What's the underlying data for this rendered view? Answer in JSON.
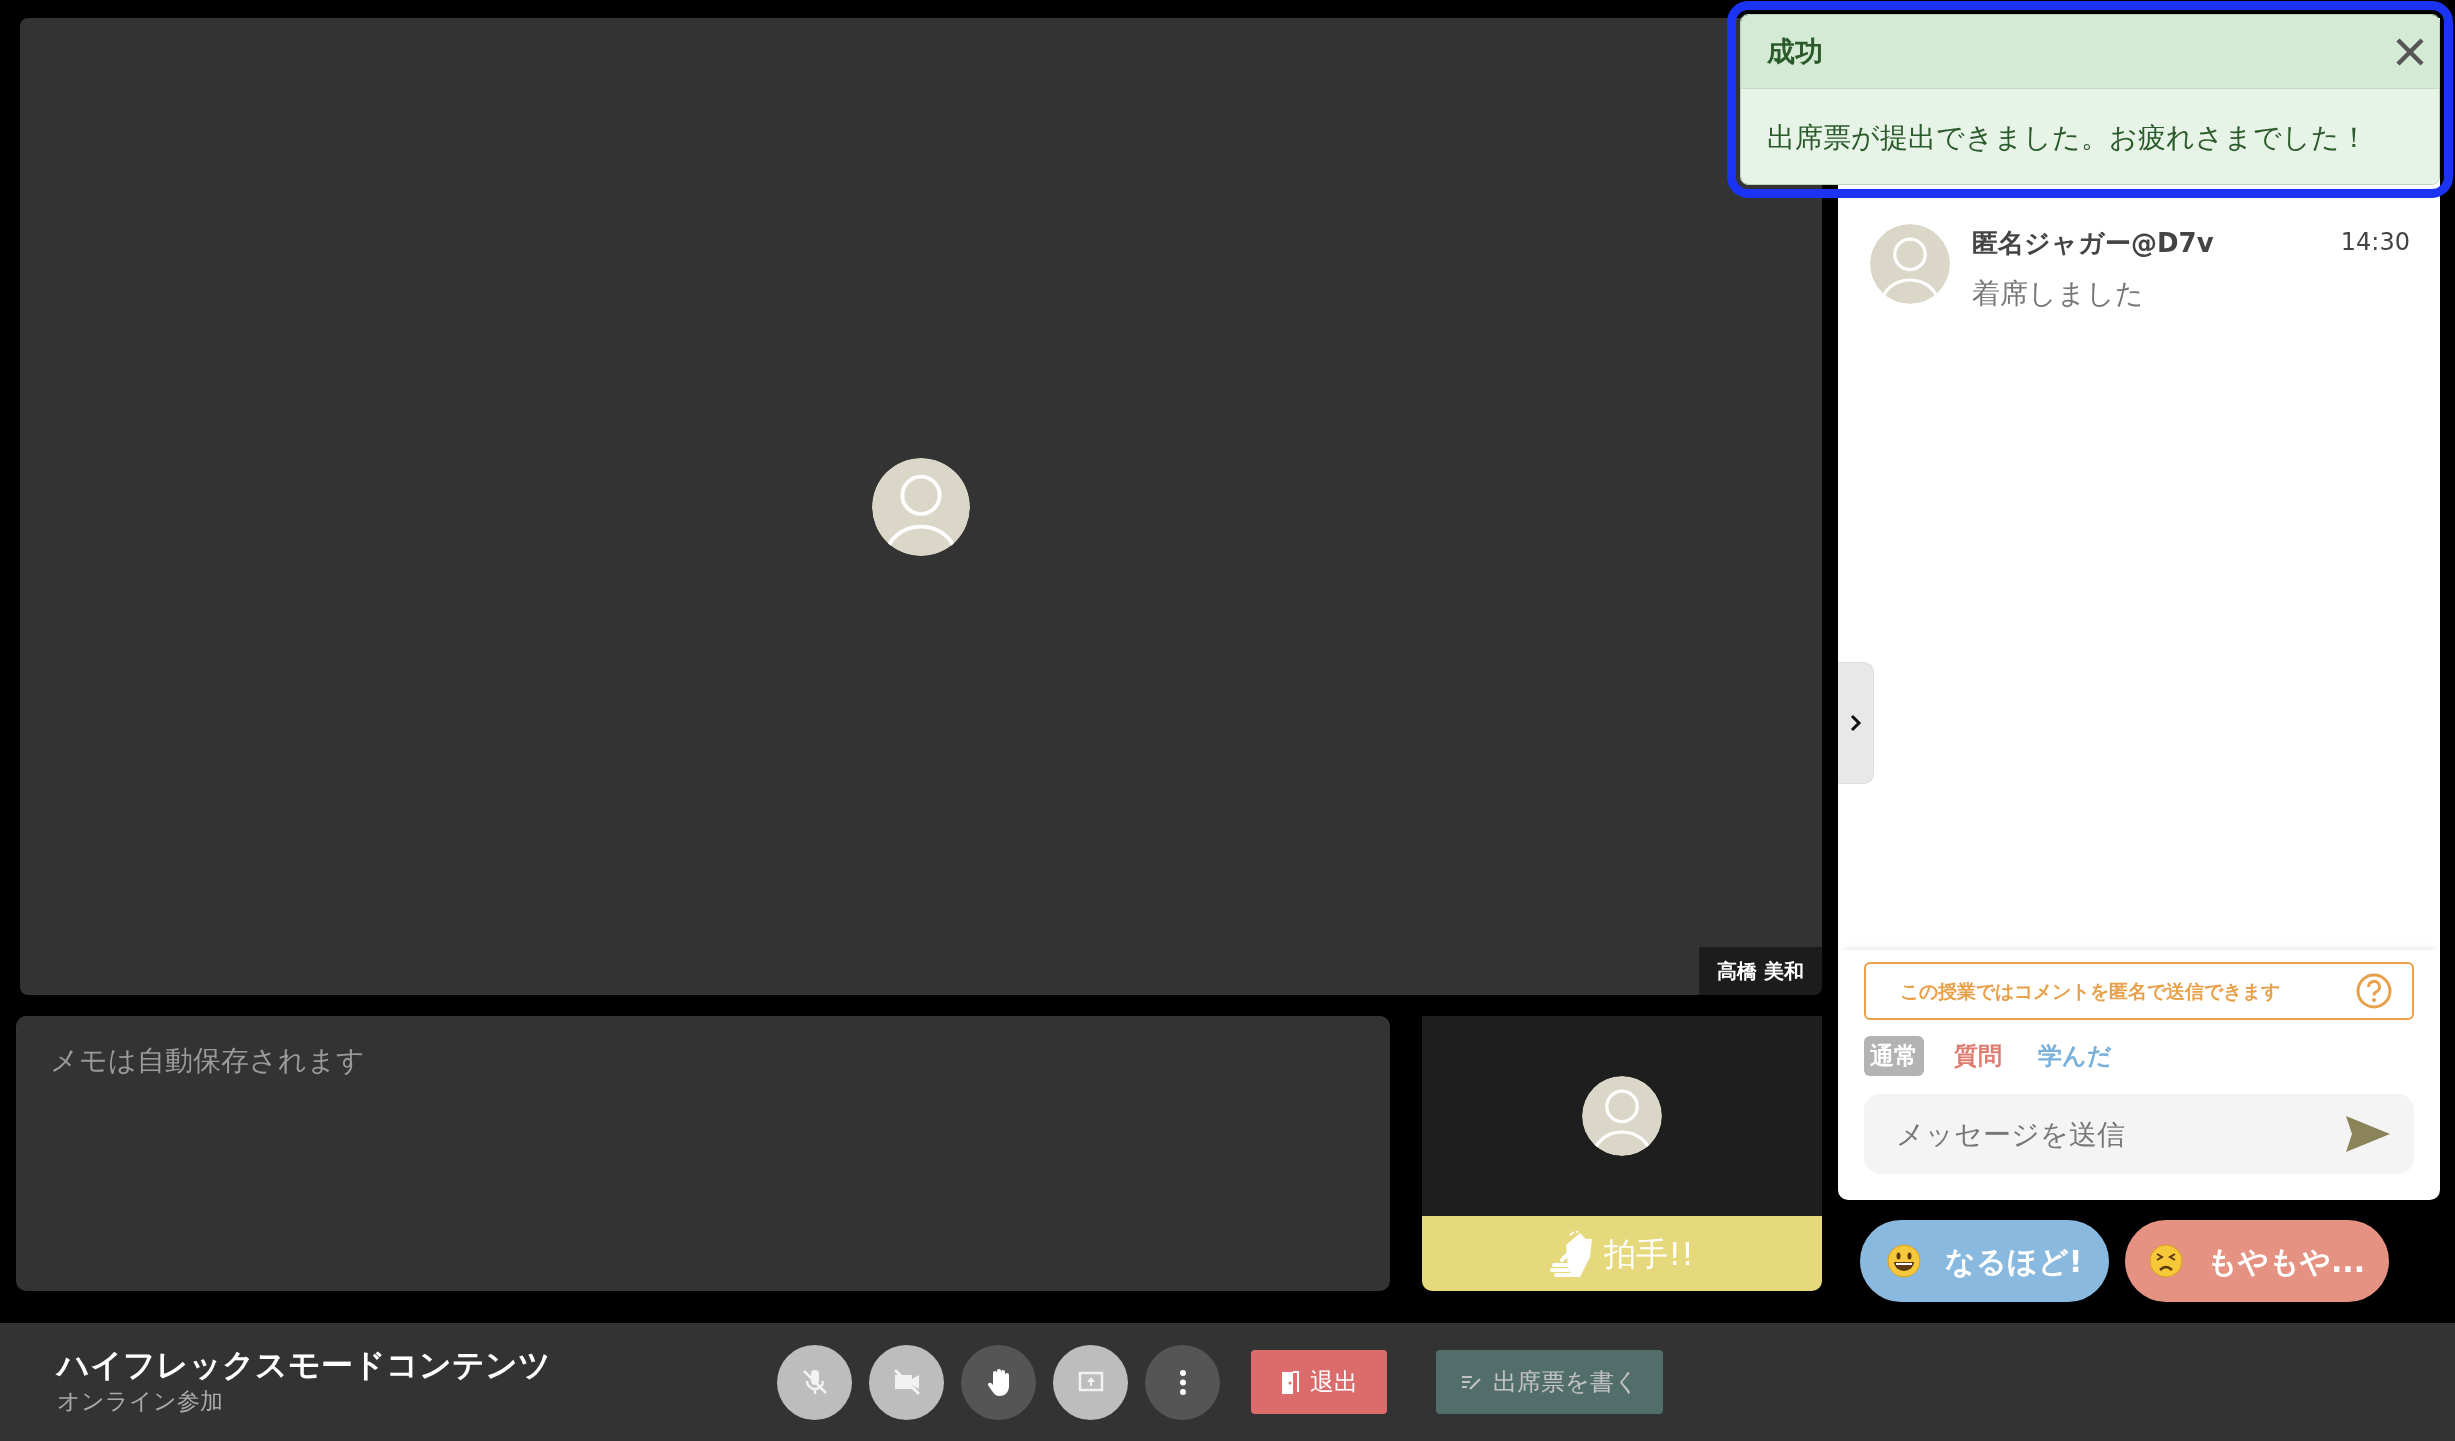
{
  "main_video": {
    "name": "高橋 美和"
  },
  "memo": {
    "placeholder": "メモは自動保存されます"
  },
  "self_video": {
    "clap_label": "拍手!!"
  },
  "panel": {
    "messages": [
      {
        "author": "匿名ジャガー@D7v",
        "time": "14:30",
        "text": "着席しました"
      }
    ],
    "anonymous_notice": "この授業ではコメントを匿名で送信できます",
    "comment_types": [
      {
        "label": "通常",
        "selected": true,
        "color": "#b3b3b3"
      },
      {
        "label": "質問",
        "selected": false,
        "color": "#e07b6f"
      },
      {
        "label": "学んだ",
        "selected": false,
        "color": "#7ab0dc"
      }
    ],
    "message_input": {
      "placeholder": "メッセージを送信"
    }
  },
  "reactions": [
    {
      "kind": "smile",
      "label": "なるほど!",
      "color": "#8ab9e0"
    },
    {
      "kind": "frown",
      "label": "もやもや...",
      "color": "#e59282"
    }
  ],
  "footer": {
    "title": "ハイフレックスモードコンテンツ",
    "subtitle": "オンライン参加",
    "controls": [
      {
        "kind": "mic",
        "disabled": true
      },
      {
        "kind": "camera",
        "disabled": true
      },
      {
        "kind": "hand",
        "disabled": false
      },
      {
        "kind": "share",
        "disabled": true
      },
      {
        "kind": "more",
        "disabled": false
      }
    ],
    "leave_button": "退出",
    "attendance_button": {
      "label": "出席票を書く",
      "disabled": true
    }
  },
  "toast": {
    "title": "成功",
    "message": "出席票が提出できました。お疲れさまでした！",
    "focused": true
  }
}
